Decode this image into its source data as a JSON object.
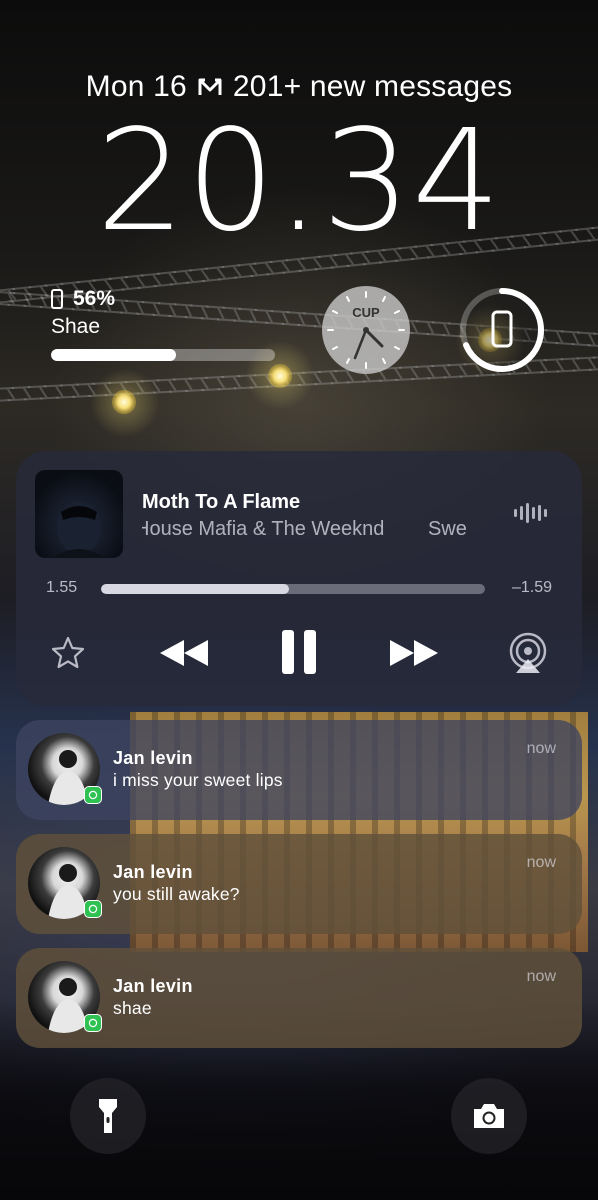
{
  "lock_screen": {
    "date": "Mon 16",
    "mail_summary": "201+ new messages",
    "time": "20.34"
  },
  "widgets": {
    "battery": {
      "percent_text": "56%",
      "percent_value": 56,
      "device_name": "Shae"
    },
    "world_clock": {
      "city_code": "CUP"
    }
  },
  "now_playing": {
    "title": "Moth To A Flame",
    "artist": "House Mafia & The Weeknd",
    "album_fragment": "Swe",
    "elapsed": "1.55",
    "remaining": "–1.59",
    "progress": 0.49
  },
  "notifications": [
    {
      "sender": "Jan levin",
      "message": "i miss your sweet lips",
      "time": "now",
      "app": "whatsapp-icon"
    },
    {
      "sender": "Jan levin",
      "message": "you still awake?",
      "time": "now",
      "app": "whatsapp-icon"
    },
    {
      "sender": "Jan levin",
      "message": "shae",
      "time": "now",
      "app": "whatsapp-icon"
    }
  ],
  "icons": {
    "mail": "mail-icon",
    "flashlight": "flashlight-icon",
    "camera": "camera-icon",
    "airplay": "airplay-icon",
    "favorite": "star-icon"
  },
  "colors": {
    "whatsapp": "#2fc253",
    "player_bg": "#282a3a"
  }
}
